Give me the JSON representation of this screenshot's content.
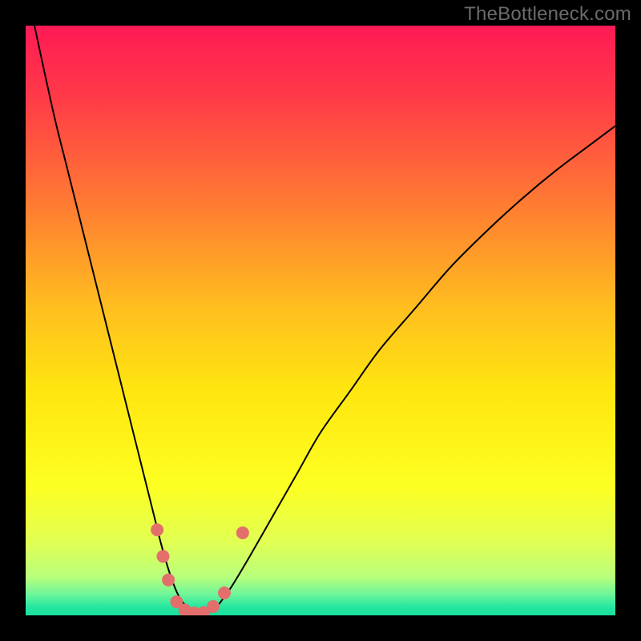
{
  "watermark": "TheBottleneck.com",
  "chart_data": {
    "type": "line",
    "title": "",
    "xlabel": "",
    "ylabel": "",
    "xlim": [
      0,
      100
    ],
    "ylim": [
      0,
      100
    ],
    "grid": false,
    "background_gradient": [
      {
        "offset": 0.0,
        "color": "#ff1a55"
      },
      {
        "offset": 0.12,
        "color": "#ff3a48"
      },
      {
        "offset": 0.3,
        "color": "#ff7a33"
      },
      {
        "offset": 0.48,
        "color": "#ffbf1f"
      },
      {
        "offset": 0.62,
        "color": "#ffe610"
      },
      {
        "offset": 0.78,
        "color": "#fdff22"
      },
      {
        "offset": 0.88,
        "color": "#dfff55"
      },
      {
        "offset": 0.935,
        "color": "#b8ff7c"
      },
      {
        "offset": 0.965,
        "color": "#6cf59a"
      },
      {
        "offset": 0.985,
        "color": "#28e7a0"
      },
      {
        "offset": 1.0,
        "color": "#19df9e"
      }
    ],
    "series": [
      {
        "name": "bottleneck-curve",
        "stroke": "#000000",
        "stroke_width": 2,
        "x": [
          1.5,
          3,
          5,
          7,
          9,
          11,
          13,
          15,
          17,
          19,
          20,
          21,
          22,
          23,
          24,
          25,
          26,
          27,
          28,
          29,
          30,
          31,
          32,
          33,
          35,
          38,
          42,
          46,
          50,
          55,
          60,
          66,
          72,
          78,
          84,
          90,
          96,
          100
        ],
        "y": [
          100,
          93,
          84,
          76,
          68,
          60,
          52,
          44,
          36,
          28,
          24,
          20,
          16,
          12,
          8.5,
          5.5,
          3.2,
          1.8,
          0.9,
          0.4,
          0.3,
          0.5,
          1.1,
          2.2,
          5,
          10,
          17,
          24,
          31,
          38,
          45,
          52,
          59,
          65,
          70.5,
          75.5,
          80,
          83
        ]
      }
    ],
    "markers": {
      "name": "highlight-dots",
      "fill": "#e36f6c",
      "radius": 8,
      "points": [
        {
          "x": 22.3,
          "y": 14.5
        },
        {
          "x": 23.3,
          "y": 10.0
        },
        {
          "x": 24.2,
          "y": 6.0
        },
        {
          "x": 25.6,
          "y": 2.3
        },
        {
          "x": 27.0,
          "y": 0.9
        },
        {
          "x": 28.6,
          "y": 0.4
        },
        {
          "x": 30.2,
          "y": 0.5
        },
        {
          "x": 31.8,
          "y": 1.5
        },
        {
          "x": 33.7,
          "y": 3.8
        },
        {
          "x": 36.8,
          "y": 14.0
        }
      ]
    }
  }
}
